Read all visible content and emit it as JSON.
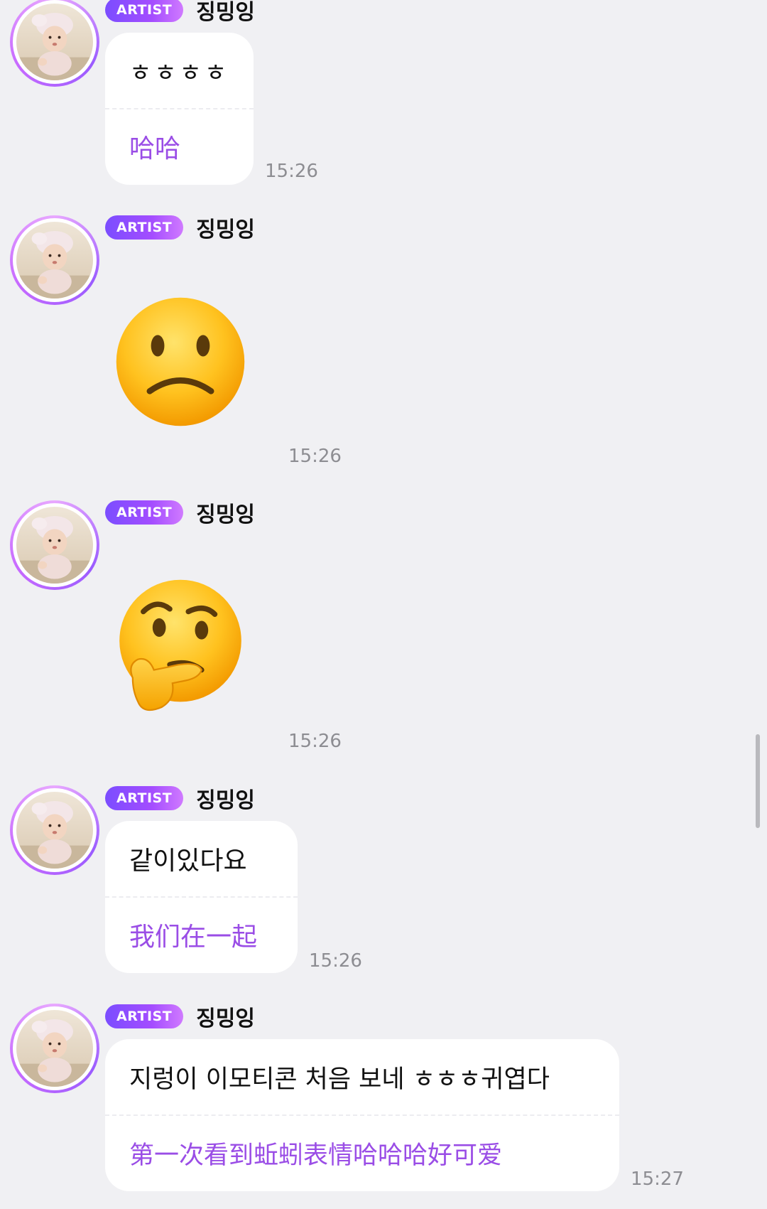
{
  "messages": [
    {
      "badge": "ARTIST",
      "name": "징밍잉",
      "text": "ㅎㅎㅎㅎ",
      "translation": "哈哈",
      "time": "15:26"
    },
    {
      "badge": "ARTIST",
      "name": "징밍잉",
      "emoji": "slightly-frowning-face-emoji",
      "time": "15:26"
    },
    {
      "badge": "ARTIST",
      "name": "징밍잉",
      "emoji": "thinking-face-emoji",
      "time": "15:26"
    },
    {
      "badge": "ARTIST",
      "name": "징밍잉",
      "text": "같이있다요",
      "translation": "我们在一起",
      "time": "15:26"
    },
    {
      "badge": "ARTIST",
      "name": "징밍잉",
      "text": "지렁이 이모티콘 처음 보네 ㅎㅎㅎ귀엽다",
      "translation": "第一次看到蚯蚓表情哈哈哈好可爱",
      "time": "15:27"
    }
  ],
  "colors": {
    "background": "#f0f0f3",
    "translation_text": "#9a4de6",
    "badge_start": "#7b4dff",
    "badge_end": "#d07aff",
    "timestamp": "#8d8d92"
  }
}
